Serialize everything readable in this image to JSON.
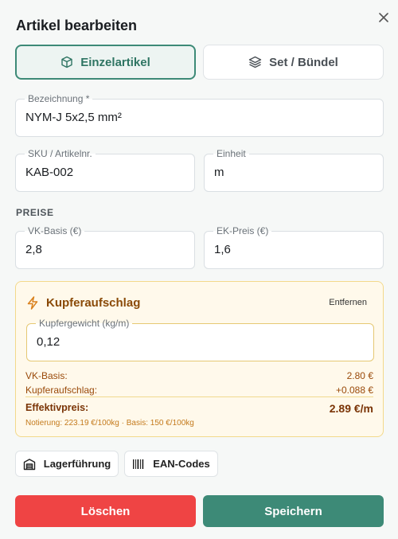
{
  "dialog": {
    "title": "Artikel bearbeiten",
    "close_icon": "close-icon"
  },
  "type_toggle": {
    "single_label": "Einzelartikel",
    "single_icon": "cube-icon",
    "set_label": "Set / Bündel",
    "set_icon": "layers-icon",
    "selected": "Einzelartikel"
  },
  "fields": {
    "name": {
      "label": "Bezeichnung *",
      "value": "NYM-J 5x2,5 mm²"
    },
    "sku": {
      "label": "SKU / Artikelnr.",
      "value": "KAB-002"
    },
    "unit": {
      "label": "Einheit",
      "value": "m"
    }
  },
  "prices": {
    "section_label": "PREISE",
    "vk": {
      "label": "VK-Basis (€)",
      "value": "2,8"
    },
    "ek": {
      "label": "EK-Preis (€)",
      "value": "1,6"
    }
  },
  "copper": {
    "title": "Kupferaufschlag",
    "icon": "lightning-icon",
    "remove_label": "Entfernen",
    "weight": {
      "label": "Kupfergewicht (kg/m)",
      "value": "0,12"
    },
    "rows": [
      {
        "label": "VK-Basis:",
        "value": "2.80 €"
      },
      {
        "label": "Kupferaufschlag:",
        "value": "+0.088 €"
      }
    ],
    "total": {
      "label": "Effektivpreis:",
      "value": "2.89 €/m"
    },
    "note": "Notierung: 223.19 €/100kg · Basis: 150 €/100kg"
  },
  "actions": {
    "stock_label": "Lagerführung",
    "stock_icon": "warehouse-icon",
    "ean_label": "EAN-Codes",
    "ean_icon": "barcode-icon",
    "delete_label": "Löschen",
    "save_label": "Speichern"
  },
  "colors": {
    "accent": "#3d8a77",
    "danger": "#ef4444",
    "warning_bg": "#fff9eb"
  }
}
